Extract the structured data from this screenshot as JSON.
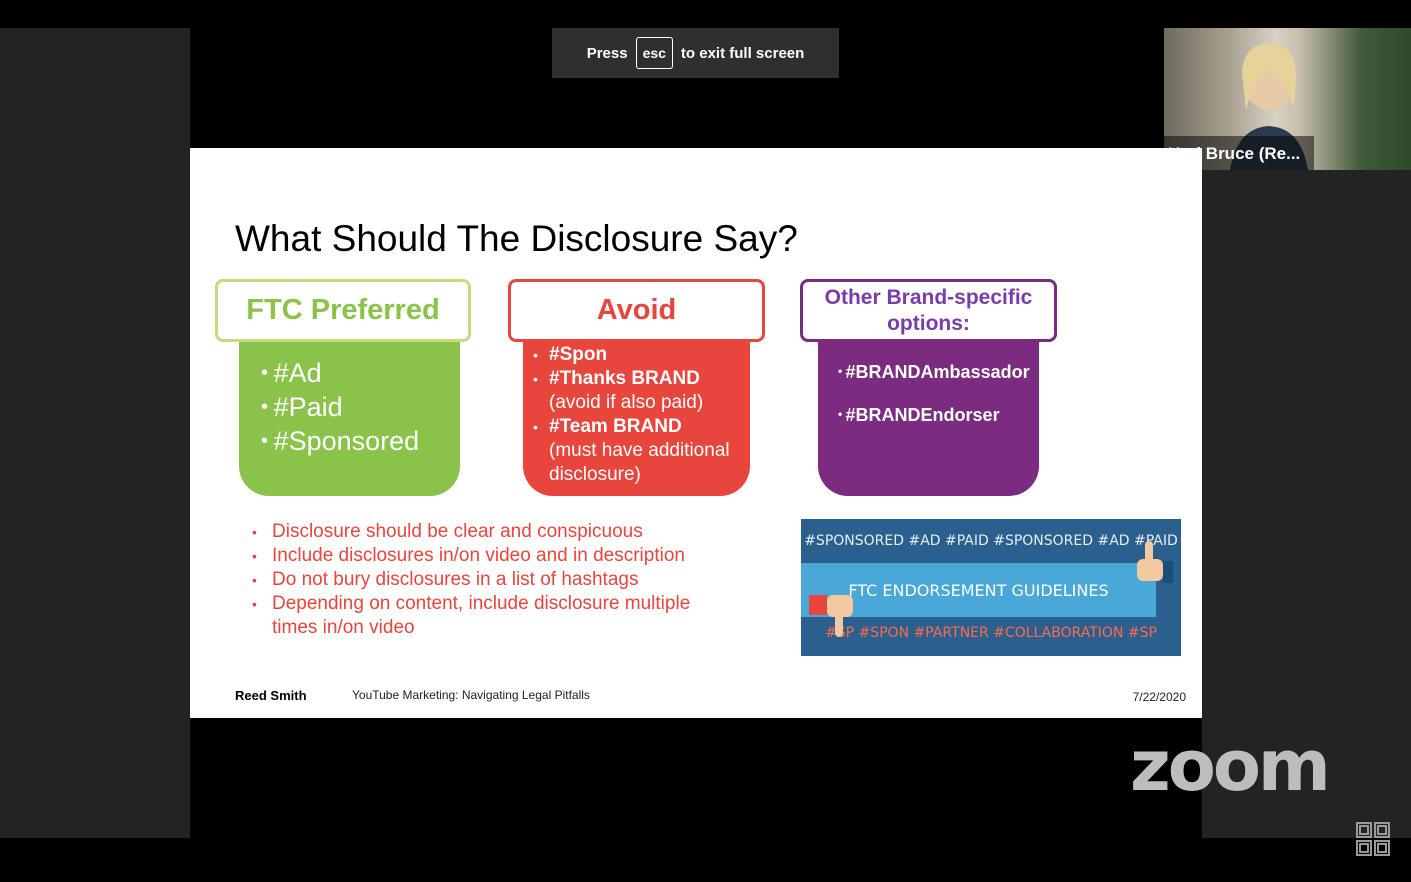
{
  "banner": {
    "press": "Press",
    "key": "esc",
    "suffix": "to exit full screen"
  },
  "participant": {
    "name": "Keri Bruce (Re..."
  },
  "slide": {
    "title": "What Should The Disclosure Say?",
    "ftc": {
      "header": "FTC Preferred",
      "items": [
        "#Ad",
        "#Paid",
        "#Sponsored"
      ]
    },
    "avoid": {
      "header": "Avoid",
      "items": [
        {
          "tag": "#Spon",
          "note": ""
        },
        {
          "tag": "#Thanks BRAND",
          "note": "(avoid if also paid)"
        },
        {
          "tag": "#Team BRAND",
          "note": "(must have additional disclosure)"
        }
      ]
    },
    "other": {
      "header": "Other Brand-specific options:",
      "items": [
        "#BRANDAmbassador",
        "#BRANDEndorser"
      ]
    },
    "notes": [
      "Disclosure should be clear and conspicuous",
      "Include disclosures in/on video and in description",
      "Do not bury disclosures in a list of hashtags",
      "Depending on content, include disclosure multiple times in/on video"
    ],
    "graphic": {
      "top_tags": "#SPONSORED #AD #PAID #SPONSORED #AD #PAID",
      "band": "FTC ENDORSEMENT GUIDELINES",
      "bottom_tags": "#SP #SPON #PARTNER #COLLABORATION #SP"
    },
    "footer": {
      "brand": "Reed Smith",
      "title": "YouTube Marketing: Navigating Legal Pitfalls",
      "date": "7/22/2020"
    }
  },
  "zoom_logo": "zoom",
  "colors": {
    "green": "#8bc34a",
    "red": "#e8453c",
    "purple": "#7b2c80"
  }
}
